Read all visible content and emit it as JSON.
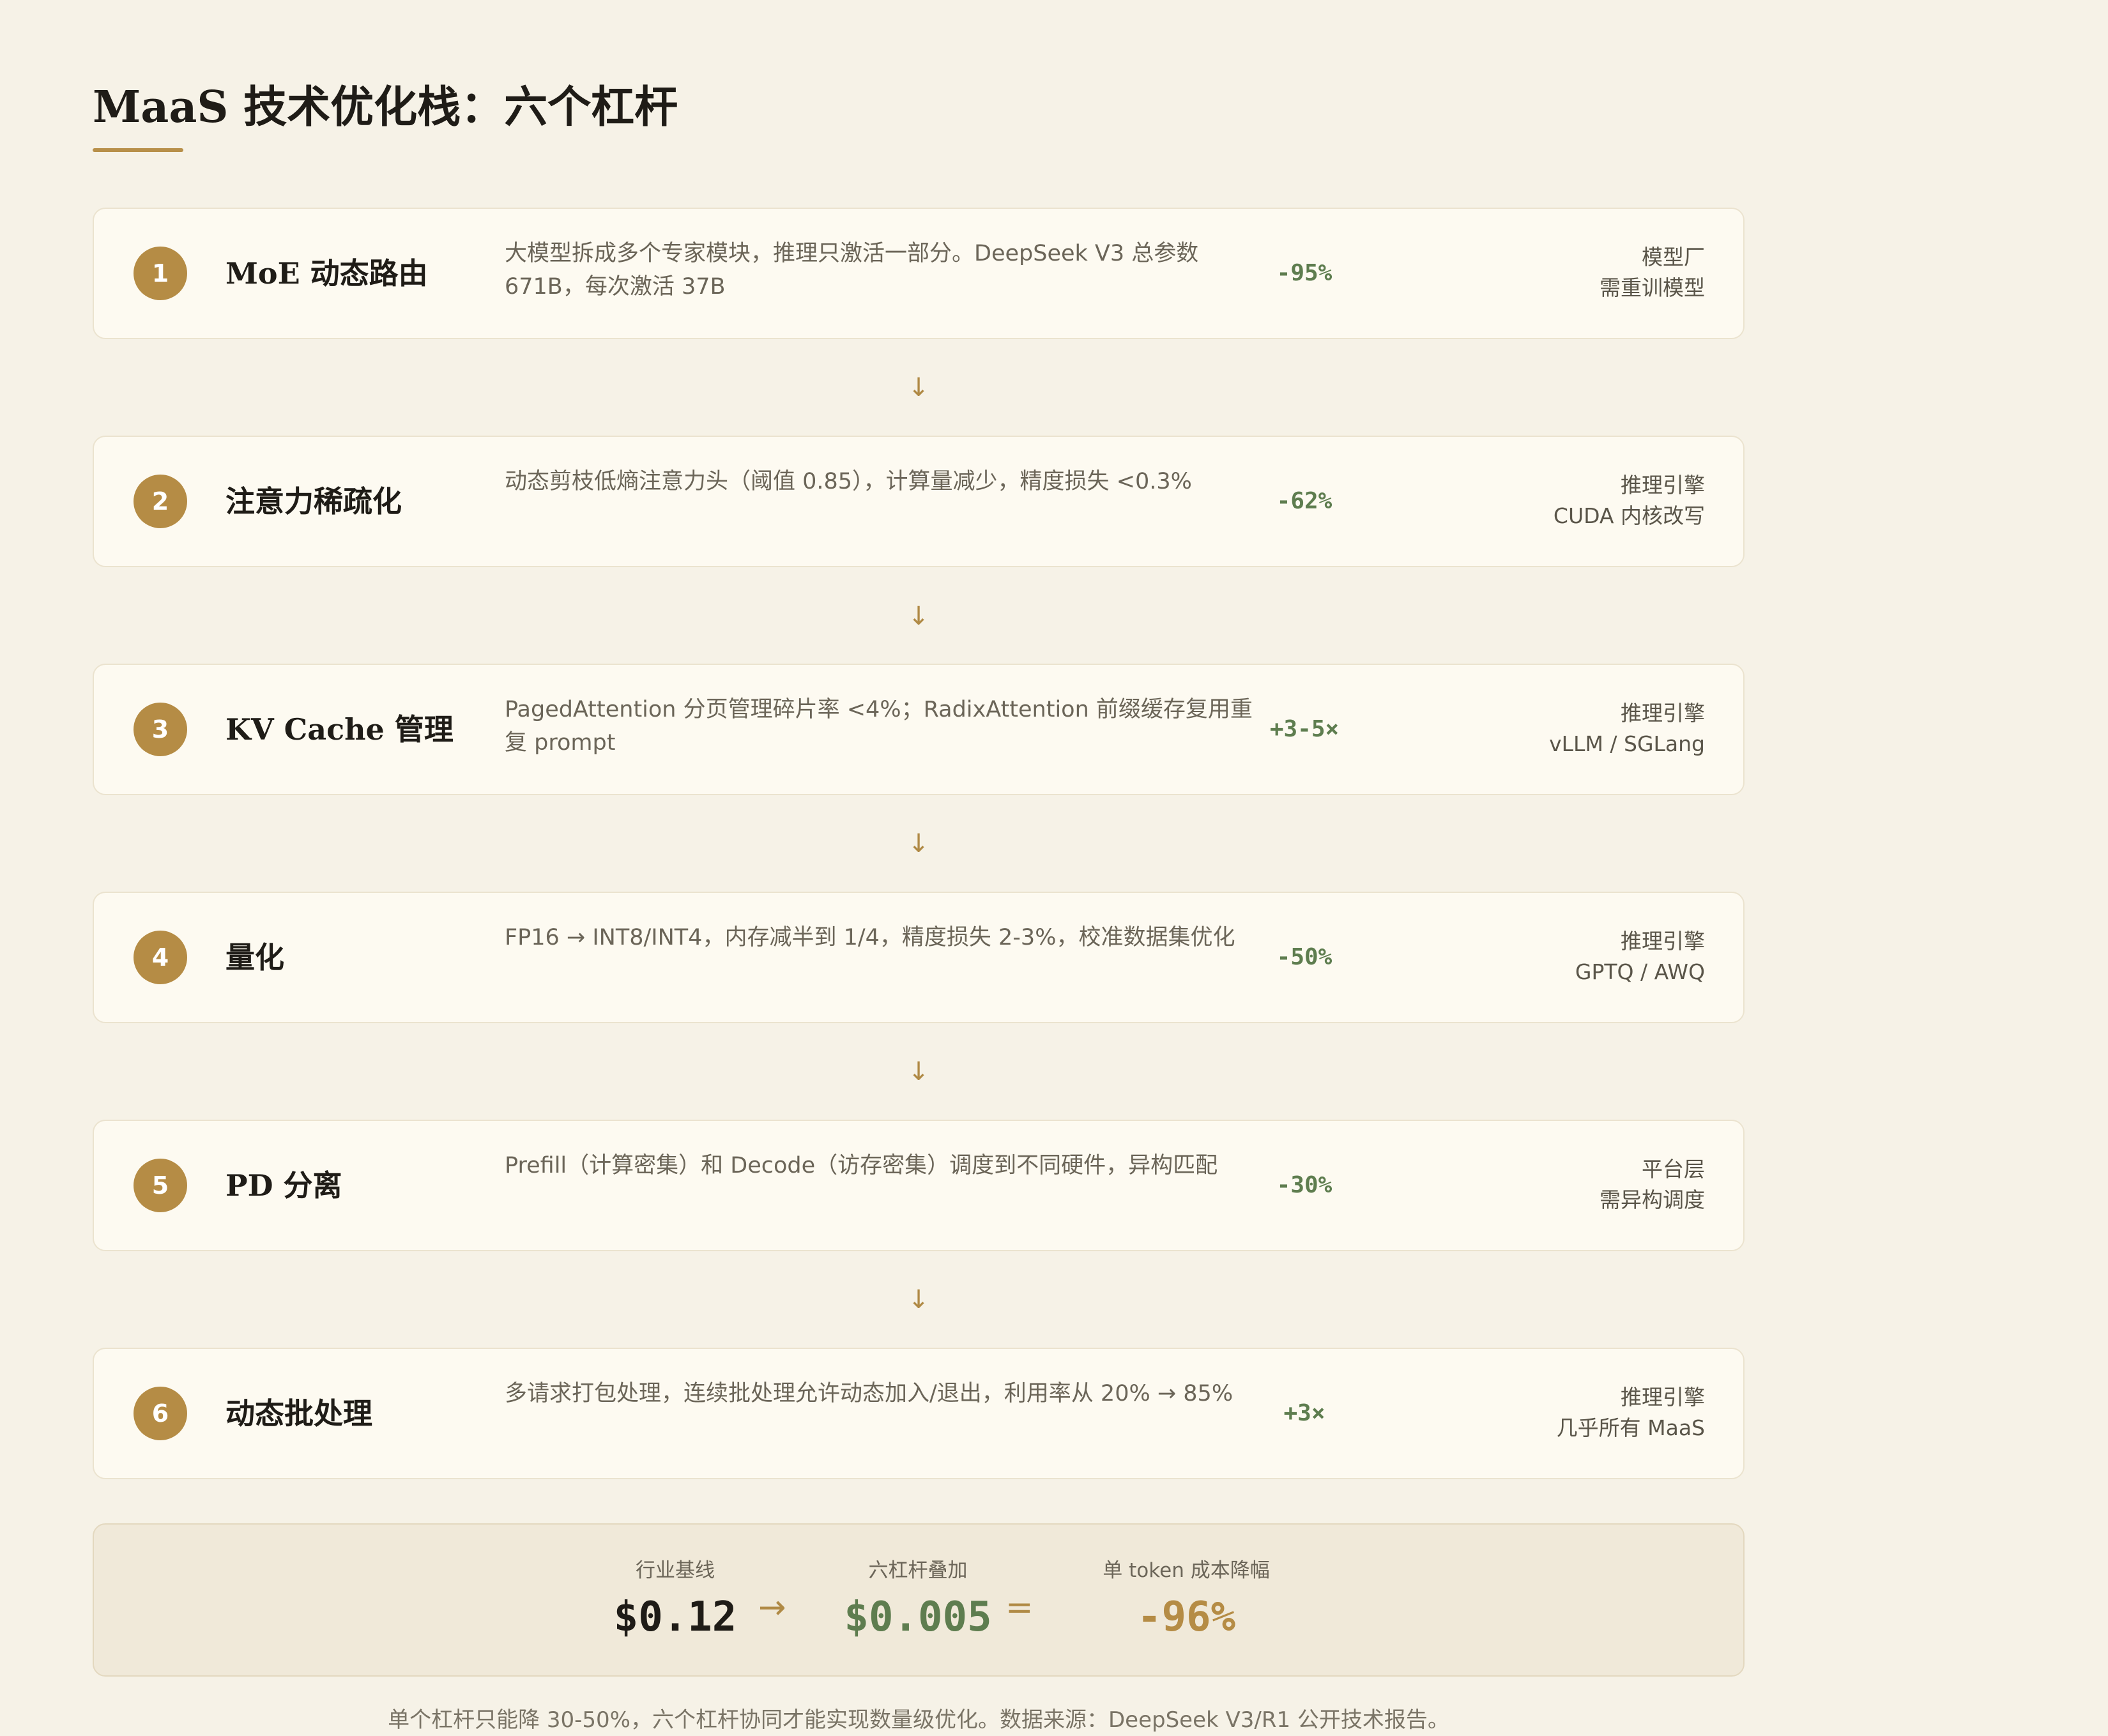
{
  "title": "MaaS 技术优化栈：六个杠杆",
  "arrow_glyph": "↓",
  "steps": [
    {
      "num": "1",
      "name": "MoE 动态路由",
      "desc": "大模型拆成多个专家模块，推理只激活一部分。DeepSeek V3 总参数 671B，每次激活 37B",
      "metric": "-95%",
      "owner": "模型厂",
      "owner_note": "需重训模型"
    },
    {
      "num": "2",
      "name": "注意力稀疏化",
      "desc": "动态剪枝低熵注意力头（阈值 0.85），计算量减少，精度损失 <0.3%",
      "metric": "-62%",
      "owner": "推理引擎",
      "owner_note": "CUDA 内核改写"
    },
    {
      "num": "3",
      "name": "KV Cache 管理",
      "desc": "PagedAttention 分页管理碎片率 <4%；RadixAttention 前缀缓存复用重复 prompt",
      "metric": "+3-5×",
      "owner": "推理引擎",
      "owner_note": "vLLM / SGLang"
    },
    {
      "num": "4",
      "name": "量化",
      "desc": "FP16 → INT8/INT4，内存减半到 1/4，精度损失 2-3%，校准数据集优化",
      "metric": "-50%",
      "owner": "推理引擎",
      "owner_note": "GPTQ / AWQ"
    },
    {
      "num": "5",
      "name": "PD 分离",
      "desc": "Prefill（计算密集）和 Decode（访存密集）调度到不同硬件，异构匹配",
      "metric": "-30%",
      "owner": "平台层",
      "owner_note": "需异构调度"
    },
    {
      "num": "6",
      "name": "动态批处理",
      "desc": "多请求打包处理，连续批处理允许动态加入/退出，利用率从 20% → 85%",
      "metric": "+3×",
      "owner": "推理引擎",
      "owner_note": "几乎所有 MaaS"
    }
  ],
  "summary": {
    "baseline_label": "行业基线",
    "baseline_value": "$0.12",
    "arrow": "→",
    "stacked_label": "六杠杆叠加",
    "stacked_value": "$0.005",
    "equals": "=",
    "reduction_label": "单 token 成本降幅",
    "reduction_value": "-96%",
    "colors": {
      "baseline": "#1f1c17",
      "stacked": "#5e7d4f",
      "reduction": "#b58c45"
    }
  },
  "footnote": "单个杠杆只能降 30-50%，六个杠杆协同才能实现数量级优化。数据来源：DeepSeek V3/R1 公开技术报告。"
}
